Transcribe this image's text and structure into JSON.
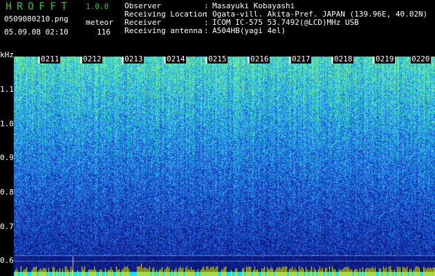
{
  "header": {
    "app_title": "HROFFT",
    "app_version": "1.0.0",
    "file_name": "0509080210.png",
    "meteor_label": "meteor",
    "datetime": "05.09.08 02:10",
    "meteor_count": "116"
  },
  "info": [
    {
      "key": "Observer",
      "colon": ":",
      "value": "Masayuki Kobayashi"
    },
    {
      "key": "Receiving Location",
      "colon": ":",
      "value": "Ogata-vill. Akita-Pref. JAPAN (139.96E, 40.02N)"
    },
    {
      "key": "Receiver",
      "colon": ":",
      "value": "ICOM IC-575 53.7492(@LCD)MHz USB"
    },
    {
      "key": "Receiving antenna",
      "colon": ":",
      "value": "A504HB(yagi 4el)"
    }
  ],
  "y_axis": {
    "unit": "kHz",
    "ticks": [
      "1.1",
      "1.0",
      "0.9",
      "0.8",
      "0.7",
      "0.6"
    ]
  },
  "time_ticks": [
    "0211",
    "0212",
    "0213",
    "0214",
    "0215",
    "0216",
    "0217",
    "0218",
    "0219",
    "0220"
  ],
  "colors": {
    "title_green": "#29c229",
    "spectrogram_low": "#0a1a8a",
    "spectrogram_mid": "#1e6fd9",
    "spectrogram_high": "#2fe0c8",
    "baseline_yellow": "#e8e81a",
    "baseline_cyan": "#00e8ff"
  }
}
